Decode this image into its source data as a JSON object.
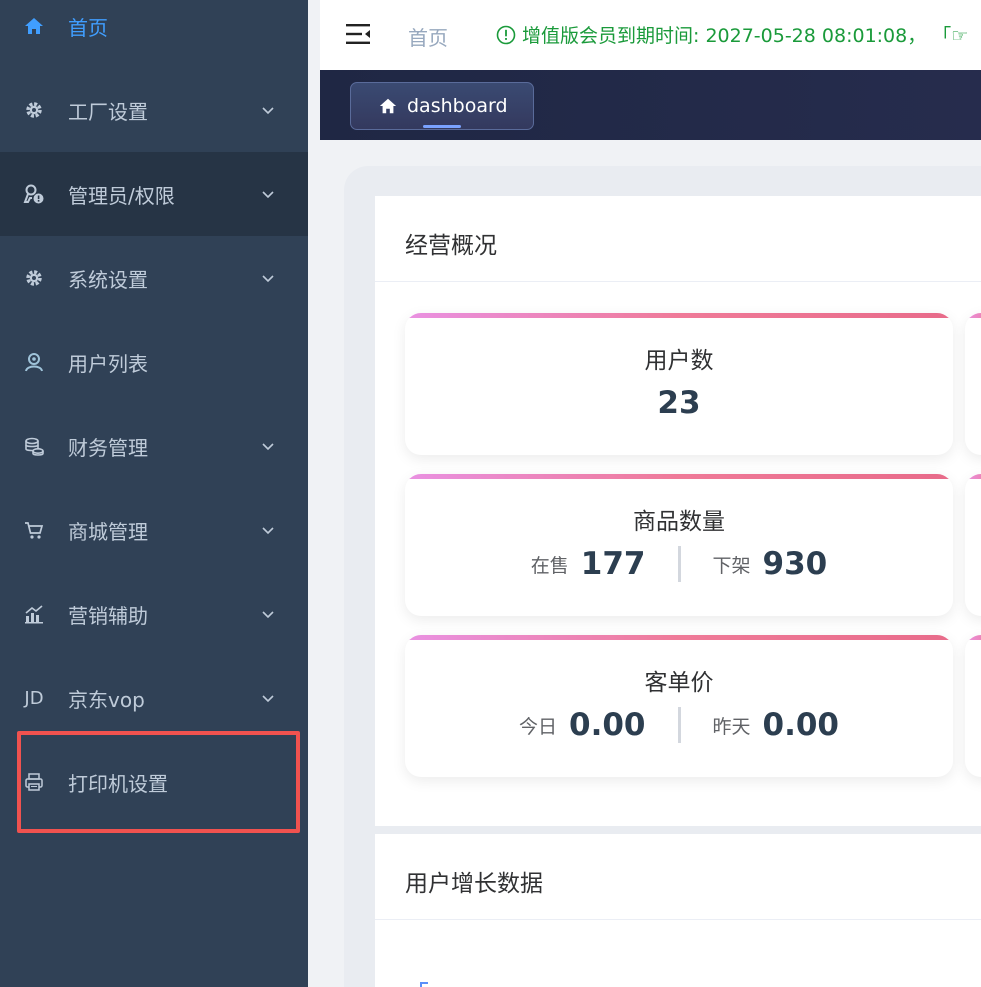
{
  "sidebar": {
    "items": [
      {
        "label": "首页",
        "icon": "home-icon",
        "has_arrow": false
      },
      {
        "label": "工厂设置",
        "icon": "gear-icon",
        "has_arrow": true
      },
      {
        "label": "管理员/权限",
        "icon": "user-key-icon",
        "has_arrow": true
      },
      {
        "label": "系统设置",
        "icon": "gear-icon",
        "has_arrow": true
      },
      {
        "label": "用户列表",
        "icon": "user-group-icon",
        "has_arrow": false
      },
      {
        "label": "财务管理",
        "icon": "coins-icon",
        "has_arrow": true
      },
      {
        "label": "商城管理",
        "icon": "cart-icon",
        "has_arrow": true
      },
      {
        "label": "营销辅助",
        "icon": "bar-chart-icon",
        "has_arrow": true
      },
      {
        "label": "京东vop",
        "icon": "jd-icon",
        "icon_text": "JD",
        "has_arrow": true
      },
      {
        "label": "打印机设置",
        "icon": "printer-icon",
        "has_arrow": false
      }
    ]
  },
  "header": {
    "breadcrumb": "首页",
    "notice": "增值版会员到期时间: 2027-05-28 08:01:08， 「☞"
  },
  "tags": {
    "active": "dashboard"
  },
  "overview": {
    "title": "经营概况",
    "users": {
      "title": "用户数",
      "value": "23"
    },
    "goods": {
      "title": "商品数量",
      "left_label": "在售",
      "left_value": "177",
      "right_label": "下架",
      "right_value": "930"
    },
    "avg_order": {
      "title": "客单价",
      "left_label": "今日",
      "left_value": "0.00",
      "right_label": "昨天",
      "right_value": "0.00"
    }
  },
  "growth": {
    "title": "用户增长数据"
  },
  "colors": {
    "sidebar_bg": "#304156",
    "sidebar_active_group": "#263445",
    "accent": "#409eff",
    "notice_green": "#1a9a3a",
    "highlight_red": "#f0524f",
    "card_top_gradient": "#ef7a98"
  }
}
